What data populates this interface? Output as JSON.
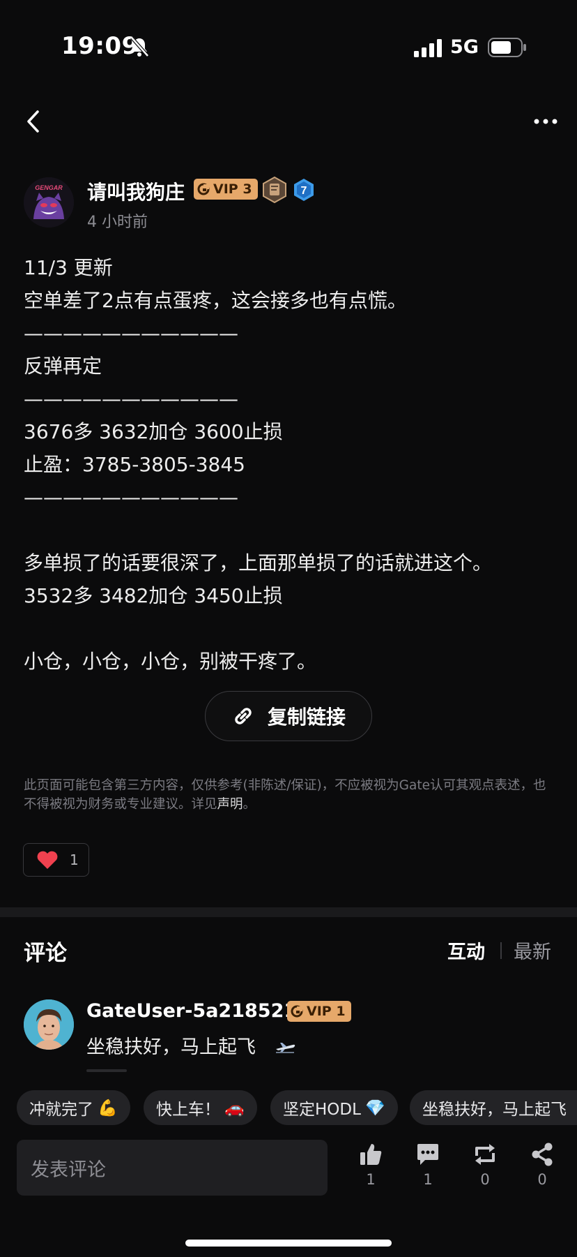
{
  "status_bar": {
    "time": "19:09",
    "network": "5G"
  },
  "author": {
    "name": "请叫我狗庄",
    "vip": "VIP 3",
    "level": "7",
    "posted": "4 小时前",
    "avatar_text": "GENGAR"
  },
  "post": {
    "lines": [
      "11/3 更新",
      "空单差了2点有点蛋疼，这会接多也有点慌。",
      "———————————",
      "反弹再定",
      "———————————",
      "3676多 3632加仓  3600止损",
      "止盈：3785-3805-3845",
      "———————————",
      "",
      "多单损了的话要很深了，上面那单损了的话就进这个。",
      "3532多 3482加仓 3450止损",
      "",
      "小仓，小仓，小仓，别被干疼了。"
    ],
    "copy_link_label": "复制链接",
    "disclaimer_text": "此页面可能包含第三方内容，仅供参考(非陈述/保证)，不应被视为Gate认可其观点表述，也不得被视为财务或专业建议。详见",
    "disclaimer_link": "声明",
    "disclaimer_end": "。",
    "likes": "1"
  },
  "comments": {
    "title": "评论",
    "tab_interact": "互动",
    "tab_latest": "最新",
    "items": [
      {
        "user": "GateUser-5a218521",
        "vip": "VIP 1",
        "text": "坐稳扶好，马上起飞"
      }
    ]
  },
  "quick_replies": [
    {
      "label": "冲就完了",
      "emoji": "💪"
    },
    {
      "label": "快上车！",
      "emoji": "🚗"
    },
    {
      "label": "坚定HODL",
      "emoji": "💎"
    },
    {
      "label": "坐稳扶好，马上起飞",
      "emoji": ""
    }
  ],
  "bottom_bar": {
    "input_placeholder": "发表评论",
    "like_count": "1",
    "comment_count": "1",
    "repost_count": "0",
    "share_count": "0"
  },
  "colors": {
    "background": "#0b0b0c",
    "vip_gold": "#e6a86a",
    "like_red": "#f0414f",
    "level_blue": "#3d9be9"
  }
}
